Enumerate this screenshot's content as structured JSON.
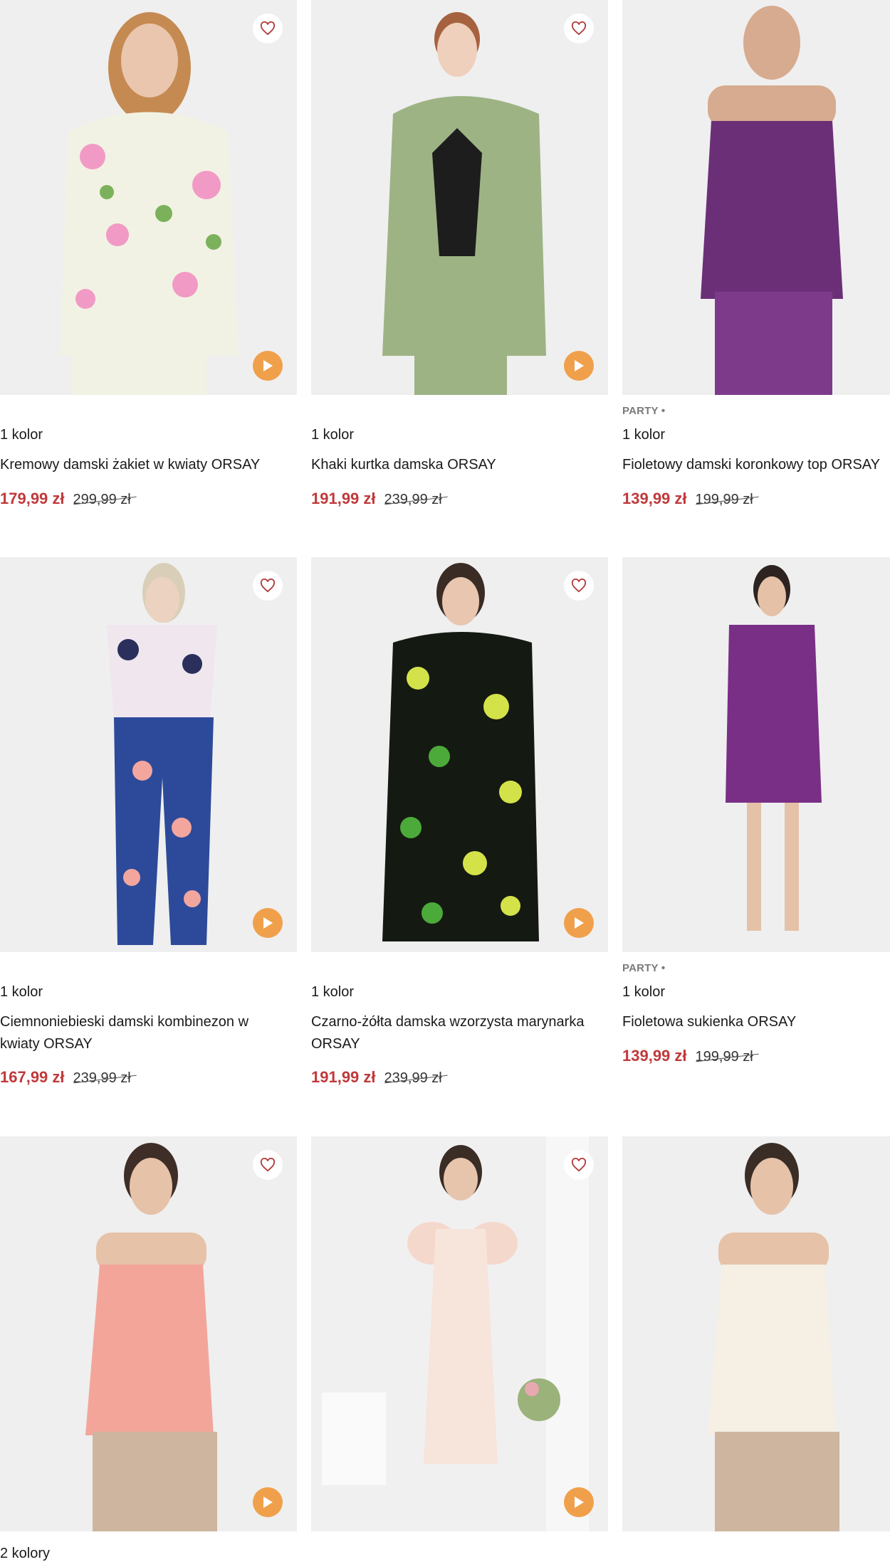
{
  "colors": {
    "price_accent": "#c0393b",
    "play_button": "#f0a04b",
    "heart": "#b23a3a",
    "photo_bg": "#eeeeef"
  },
  "icons": {
    "favorite": "heart-outline-icon",
    "video": "play-icon"
  },
  "products": [
    {
      "tag": "",
      "colors_label": "1 kolor",
      "name": "Kremowy damski żakiet w kwiaty ORSAY",
      "price": "179,99 zł",
      "old_price": "299,99 zł"
    },
    {
      "tag": "",
      "colors_label": "1 kolor",
      "name": "Khaki kurtka damska ORSAY",
      "price": "191,99 zł",
      "old_price": "239,99 zł"
    },
    {
      "tag": "PARTY •",
      "colors_label": "1 kolor",
      "name": "Fioletowy damski koronkowy top ORSAY",
      "price": "139,99 zł",
      "old_price": "199,99 zł"
    },
    {
      "tag": "",
      "colors_label": "1 kolor",
      "name": "Ciemnoniebieski damski kombinezon w kwiaty ORSAY",
      "price": "167,99 zł",
      "old_price": "239,99 zł"
    },
    {
      "tag": "",
      "colors_label": "1 kolor",
      "name": "Czarno-żółta damska wzorzysta marynarka ORSAY",
      "price": "191,99 zł",
      "old_price": "239,99 zł"
    },
    {
      "tag": "PARTY •",
      "colors_label": "1 kolor",
      "name": "Fioletowa sukienka ORSAY",
      "price": "139,99 zł",
      "old_price": "199,99 zł"
    },
    {
      "tag": "",
      "colors_label": "2 kolory",
      "name": "",
      "price": "",
      "old_price": ""
    },
    {
      "tag": "",
      "colors_label": "",
      "name": "",
      "price": "",
      "old_price": ""
    },
    {
      "tag": "",
      "colors_label": "",
      "name": "",
      "price": "",
      "old_price": ""
    }
  ]
}
